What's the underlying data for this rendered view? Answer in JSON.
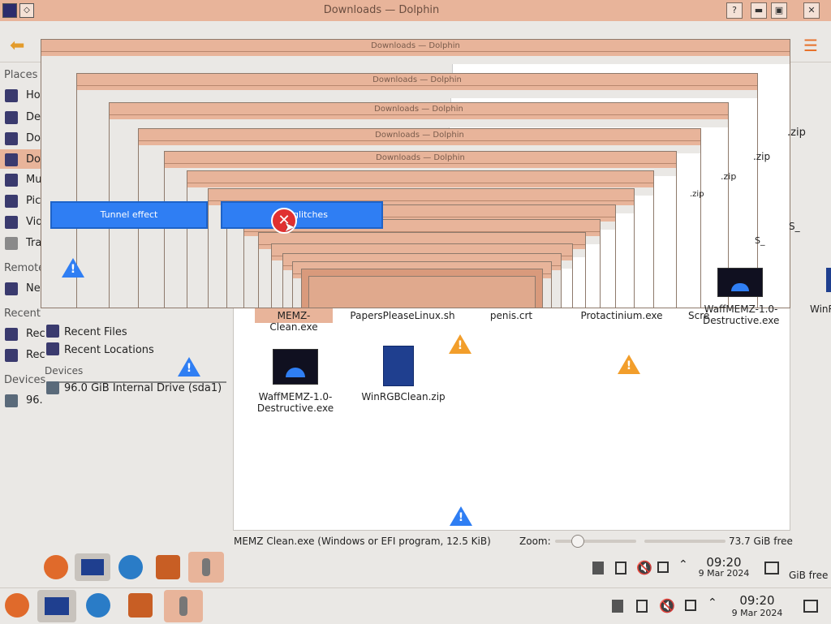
{
  "window": {
    "title": "Downloads — Dolphin",
    "btn_help": "?",
    "btn_min": "▬",
    "btn_max": "▣",
    "btn_close": "✕"
  },
  "sidebar": {
    "places": "Places",
    "remote": "Remote",
    "recent": "Recent",
    "devices": "Devices",
    "items": [
      "Ho",
      "De",
      "Do",
      "Do",
      "Mu",
      "Pic",
      "Vid",
      "Tra"
    ],
    "remote_item": "Ne",
    "recent_items": [
      "Rec",
      "Rec"
    ],
    "device_item": "96.",
    "recent_files": "Recent Files",
    "recent_locations": "Recent Locations",
    "devices_label": "Devices",
    "internal_drive": "96.0 GiB Internal Drive (sda1)"
  },
  "overlay": {
    "tunnel": "Tunnel effect",
    "glitches": "S   n glitches"
  },
  "files": {
    "memz": "MEMZ-Clean.exe",
    "papers": "PapersPleaseLinux.sh",
    "penis": "penis.crt",
    "protac": "Protactinium.exe",
    "scre": "Scre",
    "waff_r1": "WaffMEMZ-1.0-Destructive.exe",
    "winr": "WinR",
    "waff_r2": "WaffMEMZ-1.0-Destructive.exe",
    "winrgb": "WinRGBClean.zip",
    "zip1": ".zip",
    "zip2": ".zip",
    "zip3": ".zip",
    "zip4": ".zip",
    "s1": "S_",
    "s2": "S_"
  },
  "status": {
    "selection": "MEMZ Clean.exe (Windows or EFI program, 12.5 KiB)",
    "zoom_label": "Zoom:",
    "free": "73.7 GiB free",
    "free_back": "GiB free"
  },
  "clock": {
    "time": "09:20",
    "date": "9 Mar 2024"
  },
  "warn_mark": "!",
  "colors": {
    "titlebar": "#e8b49a",
    "accent": "#2f7ef3",
    "warning": "#f29e2b"
  }
}
